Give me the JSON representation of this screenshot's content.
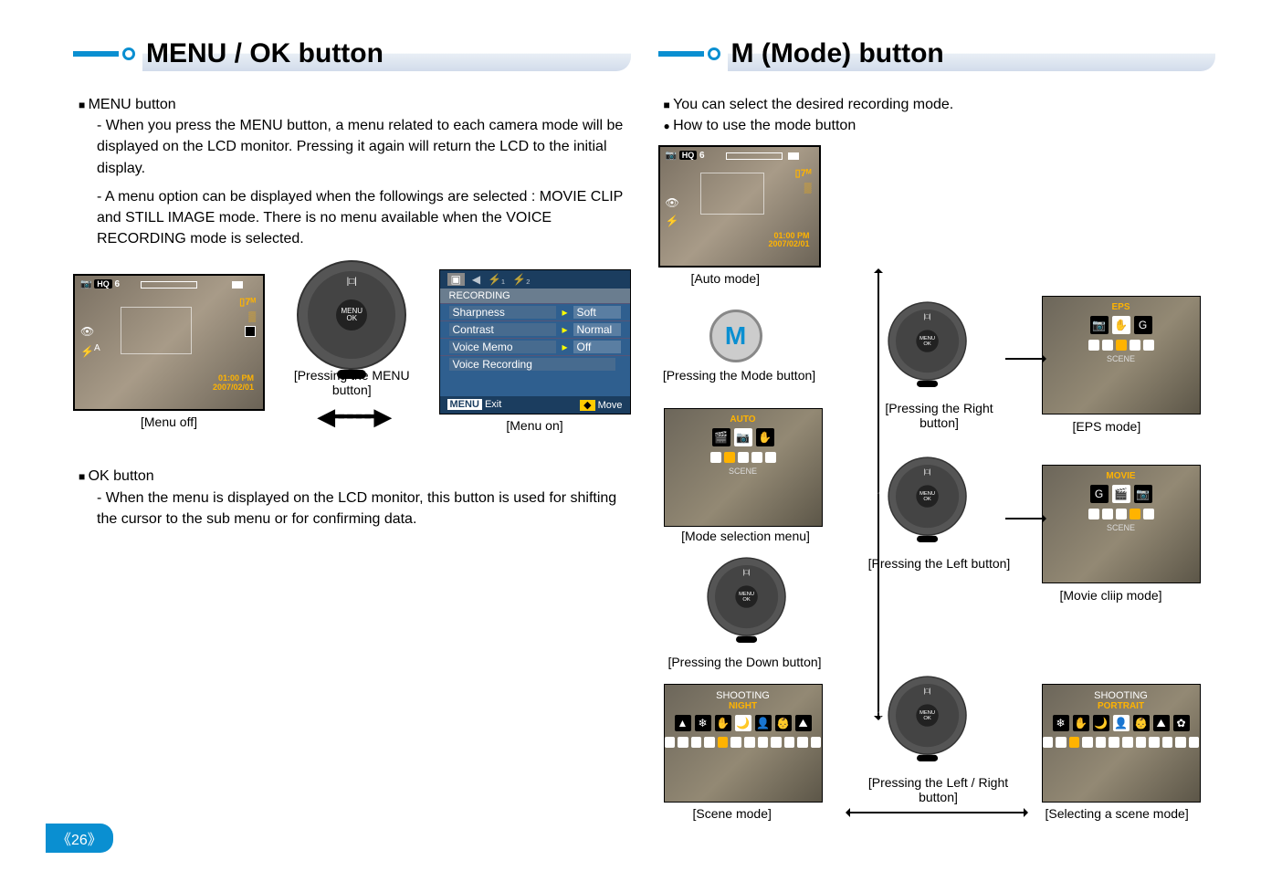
{
  "page_number_label": "《26》",
  "left": {
    "heading": "MENU / OK button",
    "menu_button_label": "MENU button",
    "menu_button_p1": "- When you press the MENU button, a menu related to each camera mode will be displayed on the LCD monitor. Pressing it again will return the LCD to the initial display.",
    "menu_button_p2": "- A menu option can be displayed when the followings are selected : MOVIE CLIP and STILL IMAGE mode. There is no menu available when the VOICE RECORDING mode is selected.",
    "ok_button_label": "OK button",
    "ok_button_p1": "- When the menu is displayed on the LCD monitor, this button is used for shifting the cursor to the sub menu or for confirming data.",
    "captions": {
      "menu_off": "[Menu off]",
      "pressing_menu": "[Pressing the MENU button]",
      "menu_on": "[Menu on]"
    },
    "lcd_overlay": {
      "topleft_hq": "HQ",
      "topleft_count": "6",
      "right_zoom": "7",
      "flash_icon": "A",
      "time1": "01:00 PM",
      "time2": "2007/02/01"
    },
    "menu_panel": {
      "section": "RECORDING",
      "rows": [
        {
          "k": "Sharpness",
          "v": "Soft"
        },
        {
          "k": "Contrast",
          "v": "Normal"
        },
        {
          "k": "Voice Memo",
          "v": "Off"
        },
        {
          "k": "Voice Recording",
          "v": ""
        }
      ],
      "foot_menu_tag": "MENU",
      "foot_exit": "Exit",
      "foot_move": "Move"
    },
    "ctrl_center": "MENU\nOK"
  },
  "right": {
    "heading": "M (Mode) button",
    "intro_bullet": "You can select the desired recording mode.",
    "howto_bullet": "How to use the mode button",
    "captions": {
      "auto_mode": "[Auto mode]",
      "pressing_mode": "[Pressing the Mode button]",
      "pressing_right": "[Pressing the Right button]",
      "eps_mode": "[EPS mode]",
      "mode_selection": "[Mode selection menu]",
      "pressing_left": "[Pressing the Left button]",
      "movie_mode": "[Movie cliip mode]",
      "pressing_down": "[Pressing the Down button]",
      "scene_mode": "[Scene mode]",
      "pressing_lr": "[Pressing the Left / Right button]",
      "selecting_scene": "[Selecting a scene mode]"
    },
    "mode_button_label": "M",
    "ctrl_center": "MENU\nOK",
    "mode_menus": {
      "selection": {
        "title": "",
        "sub": "AUTO",
        "bottom": "SCENE"
      },
      "eps": {
        "title": "",
        "sub": "EPS",
        "bottom": "SCENE"
      },
      "movie": {
        "title": "",
        "sub": "MOVIE",
        "bottom": "SCENE"
      },
      "scene": {
        "title": "SHOOTING",
        "sub": "NIGHT",
        "bottom": ""
      },
      "portrait": {
        "title": "SHOOTING",
        "sub": "PORTRAIT",
        "bottom": ""
      }
    }
  }
}
